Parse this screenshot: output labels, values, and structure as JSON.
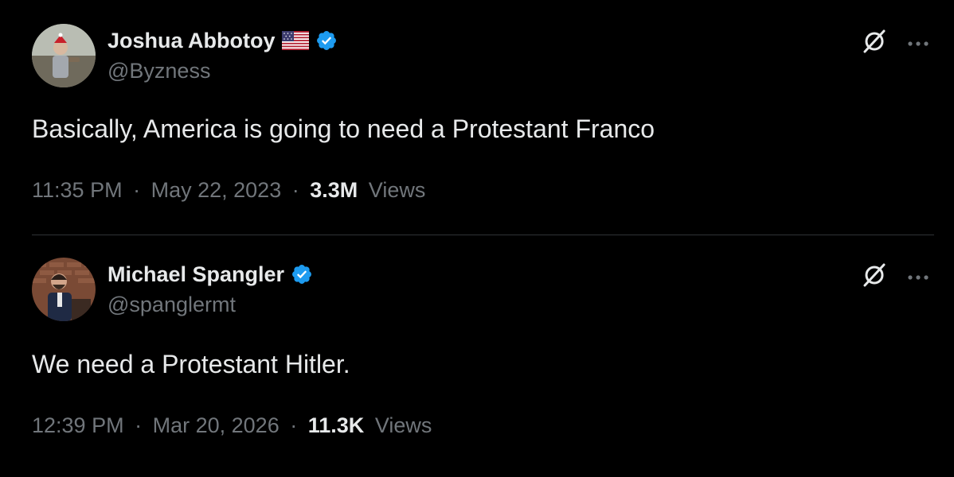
{
  "colors": {
    "background": "#000000",
    "primary_text": "#e7e9ea",
    "secondary_text": "#71767b",
    "verified_blue": "#1d9bf0",
    "divider": "#2f3336"
  },
  "tweets": [
    {
      "display_name": "Joshua Abbotoy",
      "has_flag": true,
      "flag_icon": "us-flag-icon",
      "verified": true,
      "handle": "@Byzness",
      "text": "Basically, America is going to need a Protestant Franco",
      "time": "11:35 PM",
      "date": "May 22, 2023",
      "views_count": "3.3M",
      "views_label": "Views",
      "separator": "·"
    },
    {
      "display_name": "Michael Spangler",
      "has_flag": false,
      "verified": true,
      "handle": "@spanglermt",
      "text": "We need a Protestant Hitler.",
      "time": "12:39 PM",
      "date": "Mar 20, 2026",
      "views_count": "11.3K",
      "views_label": "Views",
      "separator": "·"
    }
  ],
  "icons": {
    "verified": "verified-badge-icon",
    "grok": "grok-icon",
    "more": "more-icon"
  }
}
